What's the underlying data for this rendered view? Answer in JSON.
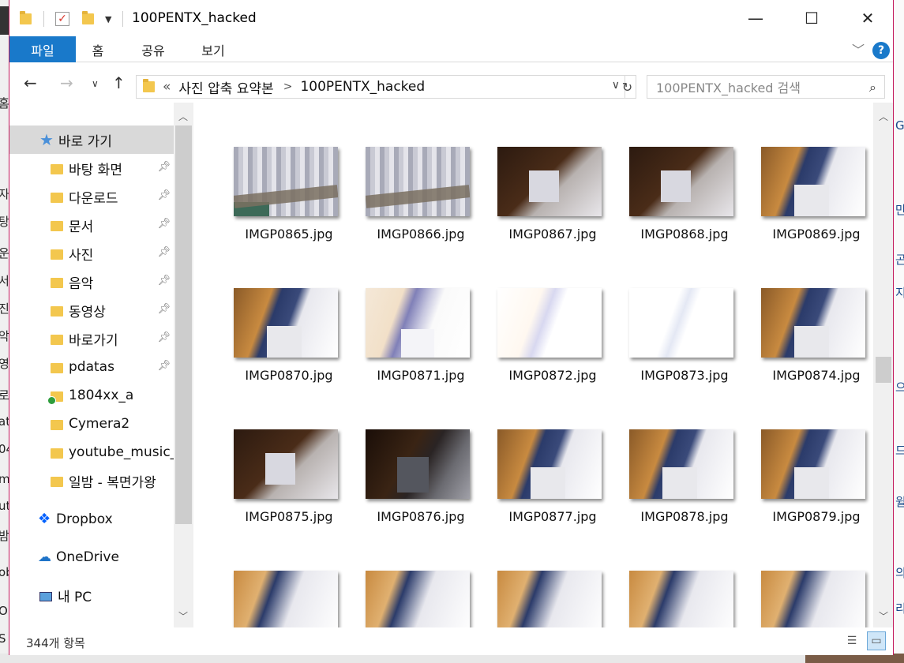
{
  "window": {
    "title": "100PENTX_hacked",
    "controls": {
      "minimize": "—",
      "maximize": "☐",
      "close": "✕"
    }
  },
  "ribbon": {
    "tabs": [
      {
        "label": "파일",
        "active": true
      },
      {
        "label": "홈",
        "active": false
      },
      {
        "label": "공유",
        "active": false
      },
      {
        "label": "보기",
        "active": false
      }
    ],
    "help": "?"
  },
  "address": {
    "overflow": "«",
    "segments": [
      "사진 압축 요약본",
      "100PENTX_hacked"
    ],
    "separator": ">",
    "search_placeholder": "100PENTX_hacked 검색"
  },
  "nav": {
    "quick_access": "바로 가기",
    "items": [
      {
        "label": "바탕 화면",
        "icon": "desktop-folder-icon",
        "pinned": true
      },
      {
        "label": "다운로드",
        "icon": "download-folder-icon",
        "pinned": true
      },
      {
        "label": "문서",
        "icon": "documents-folder-icon",
        "pinned": true
      },
      {
        "label": "사진",
        "icon": "pictures-folder-icon",
        "pinned": true
      },
      {
        "label": "음악",
        "icon": "music-folder-icon",
        "pinned": true
      },
      {
        "label": "동영상",
        "icon": "videos-folder-icon",
        "pinned": true
      },
      {
        "label": "바로가기",
        "icon": "folder-icon",
        "pinned": true
      },
      {
        "label": "pdatas",
        "icon": "folder-icon",
        "pinned": true
      },
      {
        "label": "1804xx_a",
        "icon": "synced-folder-icon",
        "pinned": false
      },
      {
        "label": "Cymera2",
        "icon": "folder-icon",
        "pinned": false
      },
      {
        "label": "youtube_music_",
        "icon": "folder-icon",
        "pinned": false
      },
      {
        "label": "일밤 - 복면가왕",
        "icon": "folder-icon",
        "pinned": false
      }
    ],
    "dropbox": "Dropbox",
    "onedrive": "OneDrive",
    "thispc": "내 PC"
  },
  "files": [
    {
      "name": "IMGP0865.jpg",
      "thumb": "t-shirt t-shirt2"
    },
    {
      "name": "IMGP0866.jpg",
      "thumb": "t-shirt"
    },
    {
      "name": "IMGP0867.jpg",
      "thumb": "t-dark"
    },
    {
      "name": "IMGP0868.jpg",
      "thumb": "t-dark"
    },
    {
      "name": "IMGP0869.jpg",
      "thumb": "t-wood"
    },
    {
      "name": "IMGP0870.jpg",
      "thumb": "t-wood"
    },
    {
      "name": "IMGP0871.jpg",
      "thumb": "t-washed"
    },
    {
      "name": "IMGP0872.jpg",
      "thumb": "t-white"
    },
    {
      "name": "IMGP0873.jpg",
      "thumb": "t-white2"
    },
    {
      "name": "IMGP0874.jpg",
      "thumb": "t-wood"
    },
    {
      "name": "IMGP0875.jpg",
      "thumb": "t-dark"
    },
    {
      "name": "IMGP0876.jpg",
      "thumb": "t-vdark"
    },
    {
      "name": "IMGP0877.jpg",
      "thumb": "t-wood"
    },
    {
      "name": "IMGP0878.jpg",
      "thumb": "t-wood"
    },
    {
      "name": "IMGP0879.jpg",
      "thumb": "t-wood"
    },
    {
      "name": "",
      "thumb": "t-part"
    },
    {
      "name": "",
      "thumb": "t-part"
    },
    {
      "name": "",
      "thumb": "t-part"
    },
    {
      "name": "",
      "thumb": "t-part"
    },
    {
      "name": "",
      "thumb": "t-part"
    }
  ],
  "status": {
    "count": "344개 항목"
  },
  "colors": {
    "accent": "#1979ca",
    "window_border": "#c2185b",
    "selected": "#d9d9d9"
  }
}
